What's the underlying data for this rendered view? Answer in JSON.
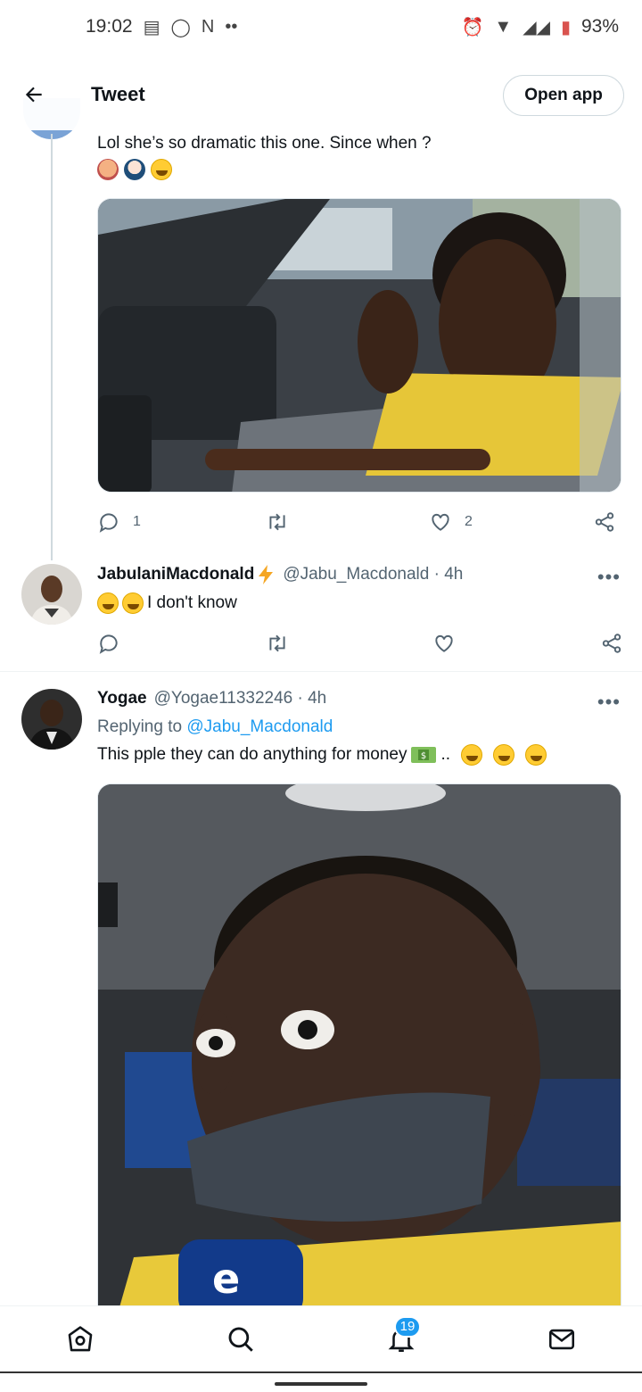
{
  "status_bar": {
    "time": "19:02",
    "battery": "93%"
  },
  "header": {
    "title": "Tweet",
    "open_app": "Open app"
  },
  "tweet1": {
    "text": "Lol she’s so dramatic this one. Since when ?",
    "reply_count": "1",
    "like_count": "2"
  },
  "reply1": {
    "name": "JabulaniMacdonald",
    "handle": "@Jabu_Macdonald · 4h",
    "text": "I don't know"
  },
  "reply2": {
    "name": "Yogae",
    "handle": "@Yogae11332246 · 4h",
    "replying_prefix": "Replying to ",
    "replying_to": "@Jabu_Macdonald",
    "text": "This pple they can do anything for money",
    "text_suffix": ".."
  },
  "bottom_nav": {
    "notifications_badge": "19"
  },
  "icons": [
    "back-arrow-icon",
    "reply-icon",
    "retweet-icon",
    "like-icon",
    "share-icon",
    "more-icon",
    "home-icon",
    "search-icon",
    "notifications-icon",
    "messages-icon"
  ],
  "colors": {
    "accent": "#1d9bf0",
    "secondary_text": "#536471",
    "lightning": "#f5a623"
  }
}
